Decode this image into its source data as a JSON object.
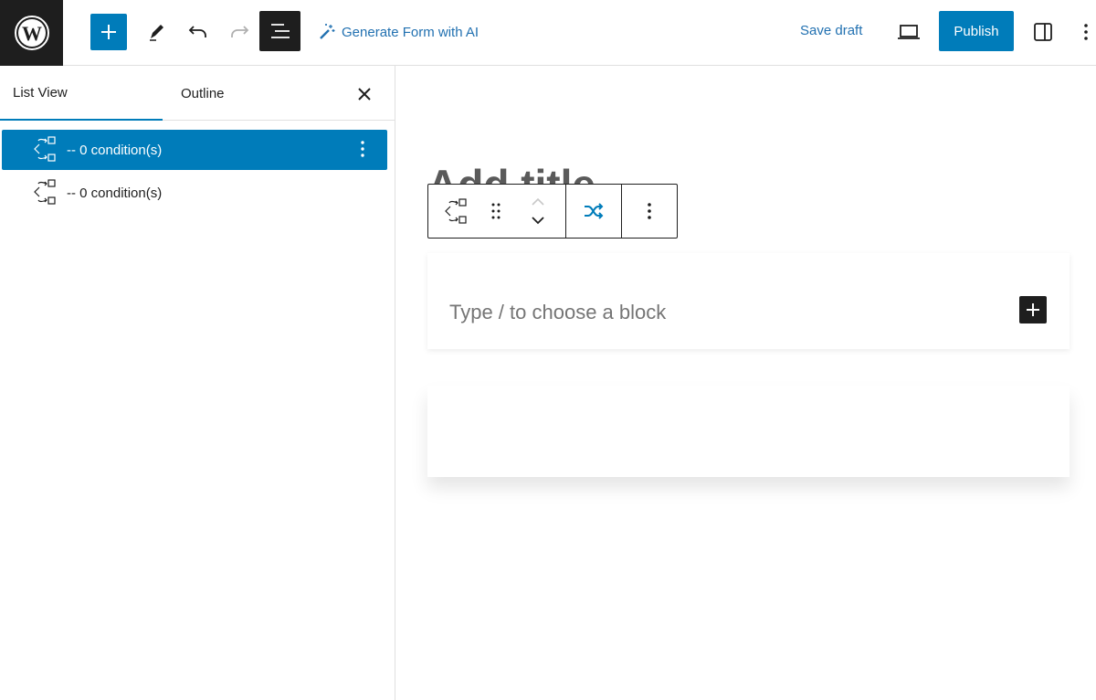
{
  "topbar": {
    "generate_ai_label": "Generate Form with AI",
    "save_draft_label": "Save draft",
    "publish_label": "Publish"
  },
  "sidebar": {
    "tabs": [
      {
        "label": "List View",
        "active": true
      },
      {
        "label": "Outline",
        "active": false
      }
    ],
    "items": [
      {
        "label": "-- 0 condition(s)",
        "selected": true
      },
      {
        "label": "-- 0 condition(s)",
        "selected": false
      }
    ]
  },
  "canvas": {
    "title_placeholder": "Add title",
    "block_placeholder": "Type / to choose a block"
  },
  "colors": {
    "accent": "#007cba",
    "link": "#2271b1",
    "dark": "#1e1e1e"
  }
}
